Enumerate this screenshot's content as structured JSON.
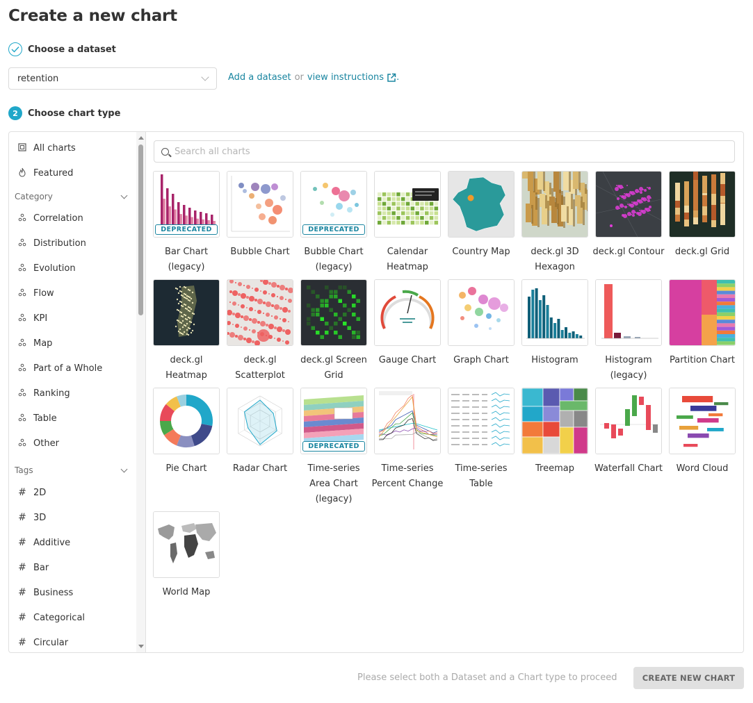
{
  "page": {
    "title": "Create a new chart"
  },
  "steps": {
    "dataset": {
      "label": "Choose a dataset",
      "number": "1"
    },
    "chart_type": {
      "label": "Choose chart type",
      "number": "2"
    }
  },
  "dataset": {
    "selected": "retention",
    "add_link": "Add a dataset",
    "or_text": "or",
    "instructions_link": "view instructions",
    "trailing": "."
  },
  "sidebar": {
    "top_items": [
      {
        "label": "All charts",
        "icon": "all-charts-icon"
      },
      {
        "label": "Featured",
        "icon": "fire-icon"
      }
    ],
    "category_label": "Category",
    "categories": [
      "Correlation",
      "Distribution",
      "Evolution",
      "Flow",
      "KPI",
      "Map",
      "Part of a Whole",
      "Ranking",
      "Table",
      "Other"
    ],
    "tags_label": "Tags",
    "tags": [
      "2D",
      "3D",
      "Additive",
      "Bar",
      "Business",
      "Categorical",
      "Circular"
    ]
  },
  "search": {
    "placeholder": "Search all charts",
    "value": ""
  },
  "charts": [
    {
      "label": "Bar Chart (legacy)",
      "badge": "DEPRECATED"
    },
    {
      "label": "Bubble Chart"
    },
    {
      "label": "Bubble Chart (legacy)",
      "badge": "DEPRECATED"
    },
    {
      "label": "Calendar Heatmap"
    },
    {
      "label": "Country Map"
    },
    {
      "label": "deck.gl 3D Hexagon"
    },
    {
      "label": "deck.gl Contour"
    },
    {
      "label": "deck.gl Grid"
    },
    {
      "label": "deck.gl Heatmap"
    },
    {
      "label": "deck.gl Scatterplot"
    },
    {
      "label": "deck.gl Screen Grid"
    },
    {
      "label": "Gauge Chart"
    },
    {
      "label": "Graph Chart"
    },
    {
      "label": "Histogram"
    },
    {
      "label": "Histogram (legacy)"
    },
    {
      "label": "Partition Chart"
    },
    {
      "label": "Pie Chart"
    },
    {
      "label": "Radar Chart"
    },
    {
      "label": "Time-series Area Chart (legacy)",
      "badge": "DEPRECATED"
    },
    {
      "label": "Time-series Percent Change"
    },
    {
      "label": "Time-series Table"
    },
    {
      "label": "Treemap"
    },
    {
      "label": "Waterfall Chart"
    },
    {
      "label": "Word Cloud"
    },
    {
      "label": "World Map"
    }
  ],
  "footer": {
    "message": "Please select both a Dataset and a Chart type to proceed",
    "create_label": "CREATE NEW CHART"
  },
  "colors": {
    "accent": "#20a7c9",
    "link": "#1985a0"
  }
}
